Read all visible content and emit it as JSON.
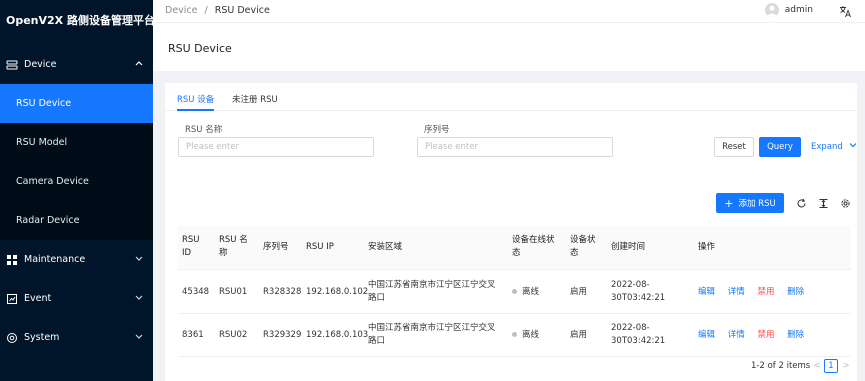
{
  "app": {
    "title": "OpenV2X 路侧设备管理平台"
  },
  "sidebar": {
    "device": {
      "label": "Device",
      "chevron": "^"
    },
    "items": [
      {
        "label": "RSU Device"
      },
      {
        "label": "RSU Model"
      },
      {
        "label": "Camera Device"
      },
      {
        "label": "Radar Device"
      }
    ],
    "maintenance": {
      "label": "Maintenance"
    },
    "event": {
      "label": "Event"
    },
    "system": {
      "label": "System"
    }
  },
  "header": {
    "breadcrumb_root": "Device",
    "breadcrumb_sep": "/",
    "breadcrumb_current": "RSU Device",
    "user": "admin",
    "lang_icon": "translate-icon"
  },
  "page": {
    "title": "RSU Device"
  },
  "tabs": [
    {
      "label": "RSU 设备",
      "active": true
    },
    {
      "label": "未注册 RSU",
      "active": false
    }
  ],
  "filter": {
    "rsu_name_label": "RSU 名称",
    "rsu_name_placeholder": "Please enter",
    "serial_label": "序列号",
    "serial_placeholder": "Please enter",
    "reset": "Reset",
    "query": "Query",
    "expand": "Expand"
  },
  "toolbar": {
    "add_label": "添加 RSU",
    "add_icon": "+"
  },
  "table": {
    "headers": {
      "rsu_id_1": "RSU",
      "rsu_id_2": "ID",
      "rsu_name_1": "RSU 名",
      "rsu_name_2": "称",
      "serial": "序列号",
      "ip": "RSU IP",
      "area": "安装区域",
      "online_1": "设备在线状",
      "online_2": "态",
      "status_1": "设备状",
      "status_2": "态",
      "created": "创建时间",
      "actions": "操作"
    },
    "rows": [
      {
        "id": "45348",
        "name": "RSU01",
        "serial": "R328328",
        "ip": "192.168.0.102",
        "area_1": "中国江苏省南京市江宁区江宁交叉",
        "area_2": "路口",
        "online": "离线",
        "status": "启用",
        "created_1": "2022-08-",
        "created_2": "30T03:42:21",
        "edit": "编辑",
        "detail": "详情",
        "disable": "禁用",
        "delete": "删除"
      },
      {
        "id": "8361",
        "name": "RSU02",
        "serial": "R329329",
        "ip": "192.168.0.103",
        "area_1": "中国江苏省南京市江宁区江宁交叉",
        "area_2": "路口",
        "online": "离线",
        "status": "启用",
        "created_1": "2022-08-",
        "created_2": "30T03:42:21",
        "edit": "编辑",
        "detail": "详情",
        "disable": "禁用",
        "delete": "删除"
      }
    ]
  },
  "pagination": {
    "summary": "1-2 of 2 items",
    "current": "1",
    "prev": "<",
    "next": ">"
  },
  "colors": {
    "primary": "#1677ff",
    "sidebar": "#001529",
    "danger": "#ff4d4f"
  }
}
